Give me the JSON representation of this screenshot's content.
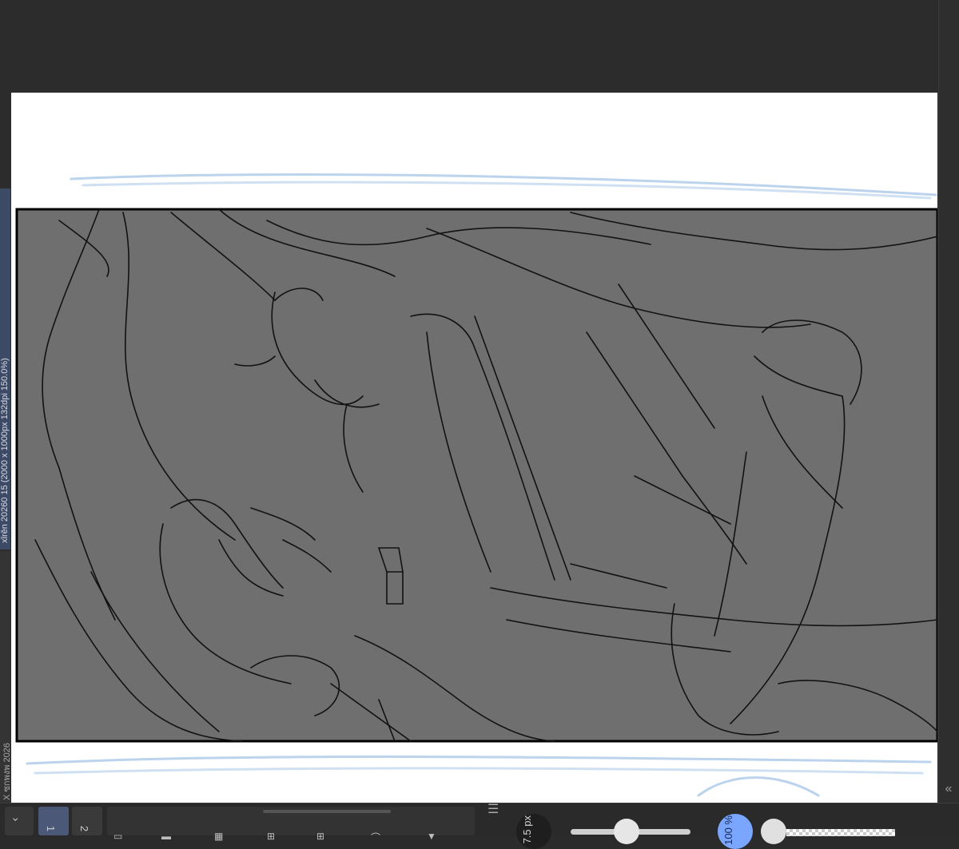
{
  "tabs": [
    {
      "label": "xǐrěn 20260 15 (2000 x 1000px 132dpi 150.0%)",
      "active": true
    },
    {
      "label": "X ซกพงพ 2026",
      "active": false
    }
  ],
  "pages": [
    "1",
    "2"
  ],
  "brush": {
    "size_label": "7.5 px"
  },
  "opacity": {
    "label": "100 %"
  },
  "accent_color": "#7aa6ff",
  "panel_fill": "#6f6f6f",
  "icons": [
    "chevron-down-icon",
    "settings-sliders-icon",
    "collapse-panel-icon",
    "frame-icon",
    "fill-icon",
    "brush-icon",
    "ruler-icon",
    "transform-icon",
    "arrow-down-icon"
  ]
}
